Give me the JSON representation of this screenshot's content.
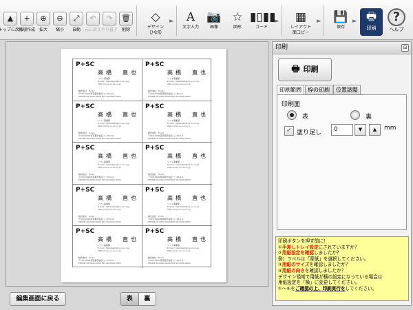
{
  "toolbar": {
    "top": "トップに戻る",
    "new": "新規作成",
    "zoom_in": "拡大",
    "zoom_out": "縮小",
    "auto": "自動",
    "undo": "元に戻す",
    "redo": "やり直す",
    "delete": "削除",
    "design": "デザイン\nひな形",
    "text": "文字入力",
    "image": "画像",
    "shape": "図形",
    "code": "コード",
    "layout": "レイアウト\n面コピー",
    "save": "保存",
    "print": "印刷",
    "help": "ヘルプ"
  },
  "card": {
    "logo": "P+SC",
    "name": "高橋　直也",
    "title_line": "ソフト事業部",
    "email_line": "E-mail : takahashi@xx-xx.co.jp",
    "url_line": "http://xxxx.xx-xx.co.jp",
    "company_line": "株式会社　P+SC",
    "address_line": "〒000-0000東京都渋谷区○○ PS-0-0",
    "phone_line": "PHONE 00-0000-0000  FAX 00-0000-0000",
    "count": 10
  },
  "bottom": {
    "back_label": "編集画面に戻る",
    "front_label": "表",
    "back_side_label": "裏"
  },
  "panel": {
    "title": "印刷",
    "print_button": "印刷",
    "tabs": [
      "印刷範囲",
      "枠の印刷",
      "位置調整"
    ],
    "side_heading": "印刷面",
    "front": "表",
    "back": "裏",
    "selected_side": "front",
    "bleed_label": "塗り足し",
    "bleed_value": "0",
    "bleed_unit": "mm",
    "notice": {
      "l1": "印刷ボタンを押す前に！",
      "l2a": "①",
      "l2b": "手差しトレイ設定",
      "l2c": "にされていますか？",
      "l3a": "②",
      "l3b": "用紙設定を確認",
      "l3c": "しましたか？",
      "l4": "例）ラベルは「厚紙」を選択してください。",
      "l5a": "③",
      "l5b": "用紙のサイズ",
      "l5c": "を確認しましたか？",
      "l6a": "④",
      "l6b": "用紙の向き",
      "l6c": "を確認しましたか？",
      "l7": "デザイン領域で用紙が横の設定になっている場合は",
      "l8": "用紙設定を「横」に変更してください。",
      "l9a": "①～④を",
      "l9b": "ご確認の上、印刷実行を",
      "l9c": "してください。"
    }
  },
  "colors": {
    "print_active_bg": "#1e3a68",
    "notice_bg": "#ffff99",
    "highlight": "#e02000"
  }
}
